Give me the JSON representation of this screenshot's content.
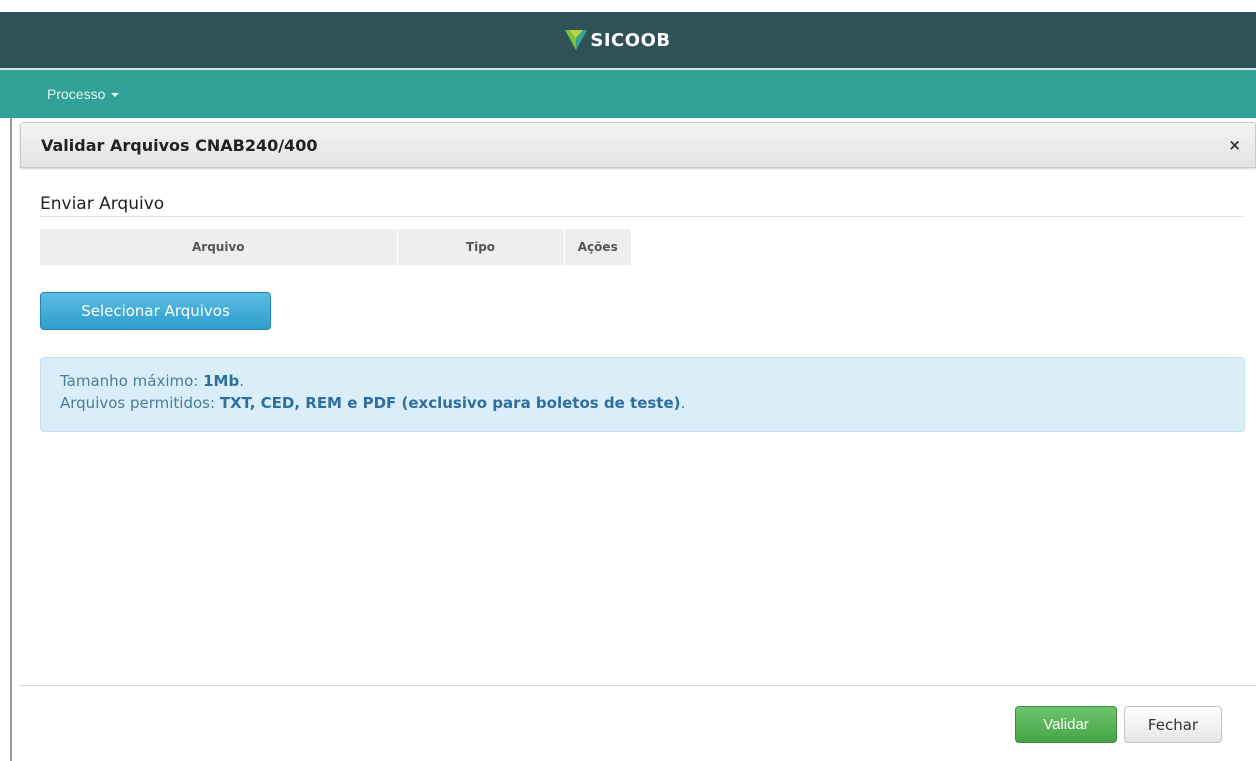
{
  "header": {
    "logo_text": "SICOOB",
    "logo_icon": "sicoob-logo-icon",
    "background": "#2f5257"
  },
  "navbar": {
    "menu_label": "Processo",
    "background": "#2fa196"
  },
  "modal": {
    "title": "Validar Arquivos CNAB240/400",
    "close_label": "×",
    "section_title": "Enviar Arquivo",
    "table": {
      "columns": [
        "Arquivo",
        "Tipo",
        "Ações"
      ]
    },
    "select_button_label": "Selecionar Arquivos",
    "info": {
      "size_label": "Tamanho máximo: ",
      "size_value": "1Mb",
      "size_suffix": ".",
      "types_label": "Arquivos permitidos: ",
      "types_value": "TXT, CED, REM e PDF (exclusivo para boletos de teste)",
      "types_suffix": "."
    },
    "footer": {
      "validate_label": "Validar",
      "close_label": "Fechar"
    }
  },
  "colors": {
    "accent_blue": "#2f9dcc",
    "success_green": "#46a446",
    "info_background": "#d9eef8"
  }
}
